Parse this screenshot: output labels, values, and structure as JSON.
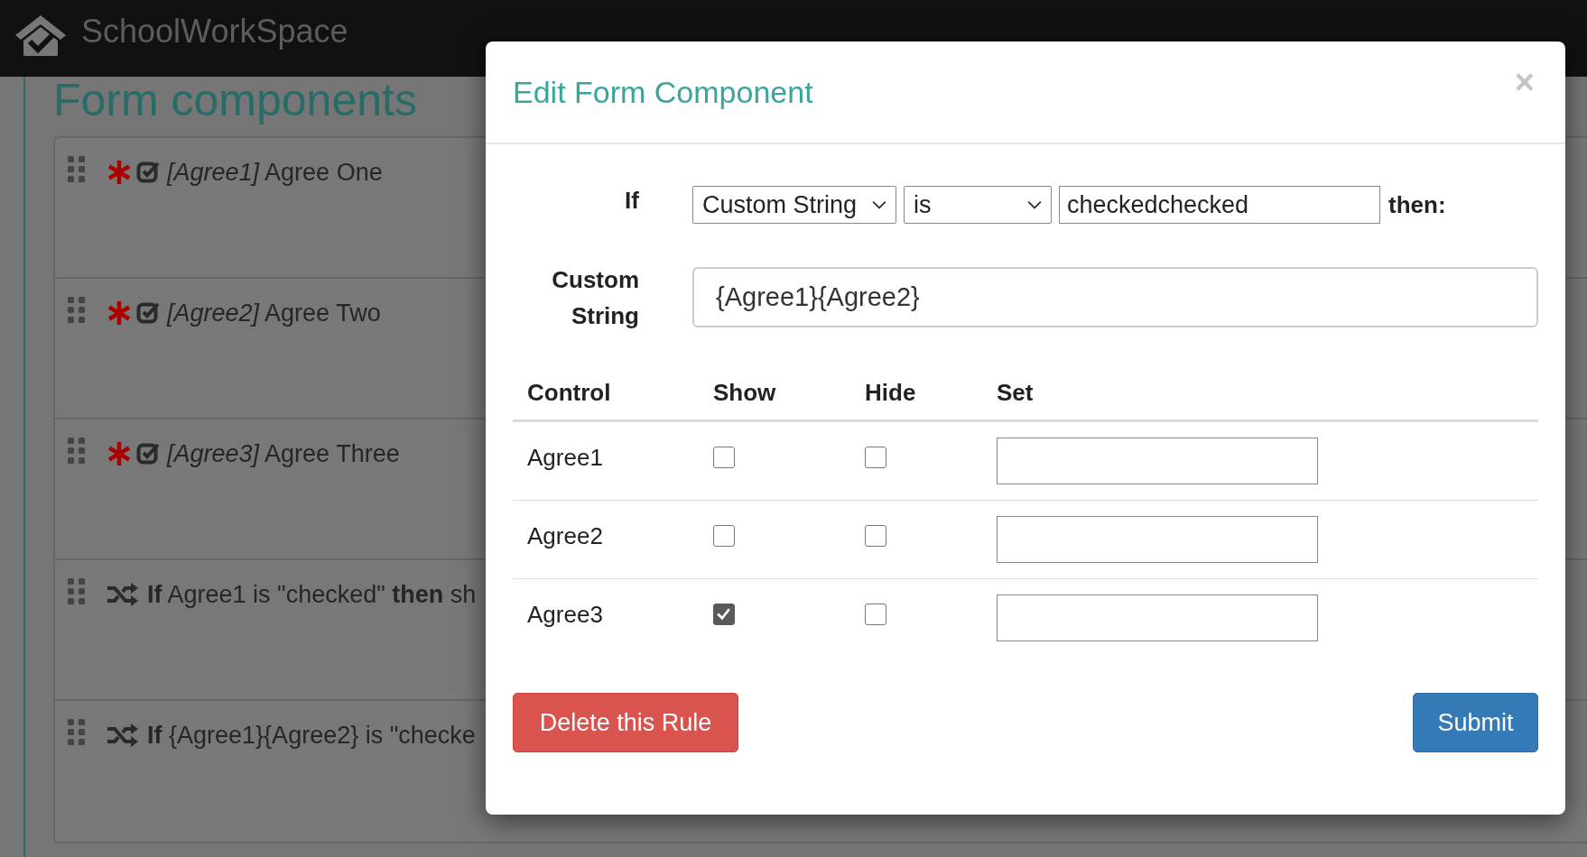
{
  "app": {
    "name": "SchoolWorkSpace"
  },
  "page": {
    "title": "Form components",
    "components": [
      {
        "kind": "field",
        "required": true,
        "tag": "[Agree1]",
        "label": "Agree One"
      },
      {
        "kind": "field",
        "required": true,
        "tag": "[Agree2]",
        "label": "Agree Two"
      },
      {
        "kind": "field",
        "required": true,
        "tag": "[Agree3]",
        "label": "Agree Three"
      },
      {
        "kind": "rule",
        "text": "**If** Agree1 is \"checked\" **then** sh"
      },
      {
        "kind": "rule",
        "text": "**If** {Agree1}{Agree2} is \"checke"
      }
    ]
  },
  "modal": {
    "title": "Edit Form Component",
    "close": "×",
    "condition": {
      "label": "If",
      "source": "Custom String",
      "operator": "is",
      "value": "checkedchecked",
      "then": "then:"
    },
    "custom_string": {
      "label": "Custom String",
      "value": "{Agree1}{Agree2}"
    },
    "table": {
      "columns": [
        "Control",
        "Show",
        "Hide",
        "Set"
      ],
      "rows": [
        {
          "control": "Agree1",
          "show": false,
          "hide": false
        },
        {
          "control": "Agree2",
          "show": false,
          "hide": false
        },
        {
          "control": "Agree3",
          "show": true,
          "hide": false
        }
      ]
    },
    "buttons": [
      {
        "kind": "danger",
        "label": "Delete this Rule"
      },
      {
        "kind": "primary",
        "label": "Submit"
      }
    ]
  }
}
